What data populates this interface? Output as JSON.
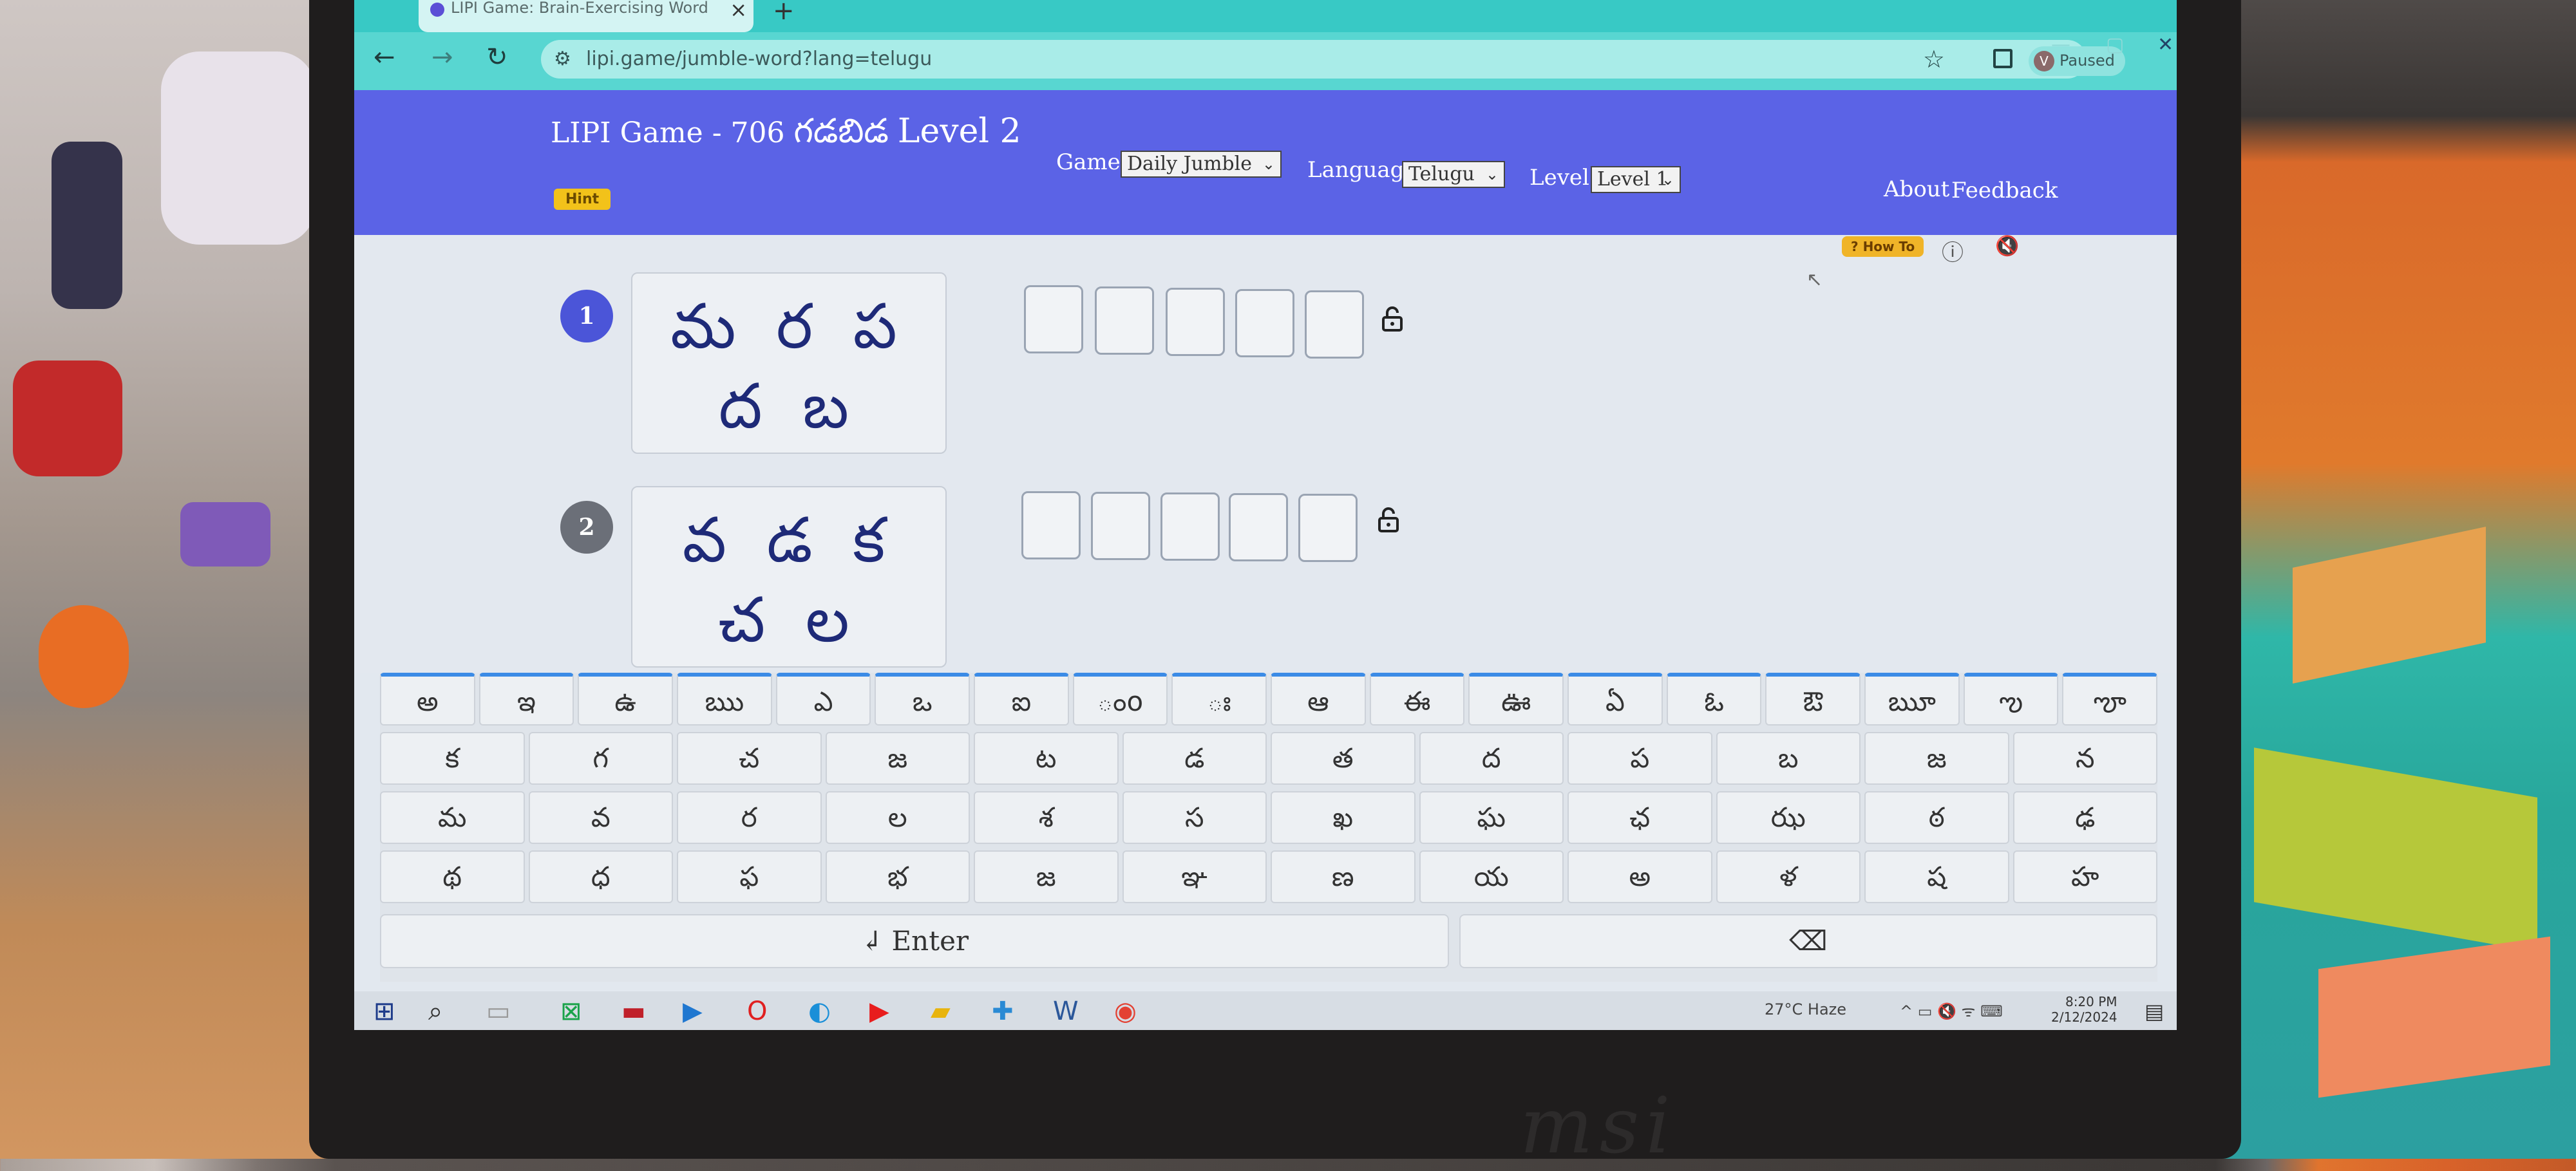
{
  "browser": {
    "tab_title": "LIPI Game: Brain-Exercising Word",
    "tab_close": "×",
    "new_tab": "+",
    "url": "lipi.game/jumble-word?lang=telugu",
    "profile_initial": "V",
    "profile_status": "Paused",
    "back": "←",
    "forward": "→",
    "reload": "↻",
    "star": "☆",
    "menu": "⋮",
    "minimize": "—",
    "maximize": "▢",
    "close": "✕"
  },
  "header": {
    "logo_prefix": "LIPI Game - 706",
    "logo_telugu": "గడబిడ",
    "logo_level": "Level 2",
    "hint": "Hint",
    "game_label": "Game",
    "game_value": "Daily Jumble",
    "language_label": "Language",
    "language_value": "Telugu",
    "level_label": "Level",
    "level_value": "Level 1",
    "about": "About",
    "feedback": "Feedback"
  },
  "toolbar": {
    "how_to": "? How To",
    "info": "ⓘ",
    "mute": "🔇"
  },
  "puzzles": [
    {
      "number": "1",
      "letters": "మ ర ప ద బ",
      "color": "#4b55d8"
    },
    {
      "number": "2",
      "letters": "వ డ క చ ల",
      "color": "#6b6f78"
    }
  ],
  "keyboard": {
    "row1": [
      "అ",
      "ఇ",
      "ఉ",
      "ఋ",
      "ఎ",
      "ఒ",
      "ఐ",
      "ంo",
      "ః",
      "ఆ",
      "ఈ",
      "ఊ",
      "ఏ",
      "ఓ",
      "ఔ",
      "ౠ",
      "ఌ",
      "ౡ"
    ],
    "row2": [
      "క",
      "గ",
      "చ",
      "జ",
      "ట",
      "డ",
      "త",
      "ద",
      "ప",
      "బ",
      "జ",
      "న"
    ],
    "row3": [
      "మ",
      "వ",
      "ర",
      "ల",
      "శ",
      "స",
      "ఖ",
      "ఘ",
      "ఛ",
      "ఝ",
      "ఠ",
      "ఢ"
    ],
    "row4": [
      "థ",
      "ధ",
      "ఫ",
      "భ",
      "జ",
      "ఞ",
      "ణ",
      "య",
      "అ",
      "ళ",
      "ష",
      "హ"
    ],
    "enter": "↲ Enter",
    "backspace": "⌫"
  },
  "taskbar": {
    "weather": "27°C  Haze",
    "time": "8:20 PM",
    "date": "2/12/2024",
    "tray": "^ ▭ 🔇 ᯤ ⌨"
  },
  "laptop_brand": "msi"
}
